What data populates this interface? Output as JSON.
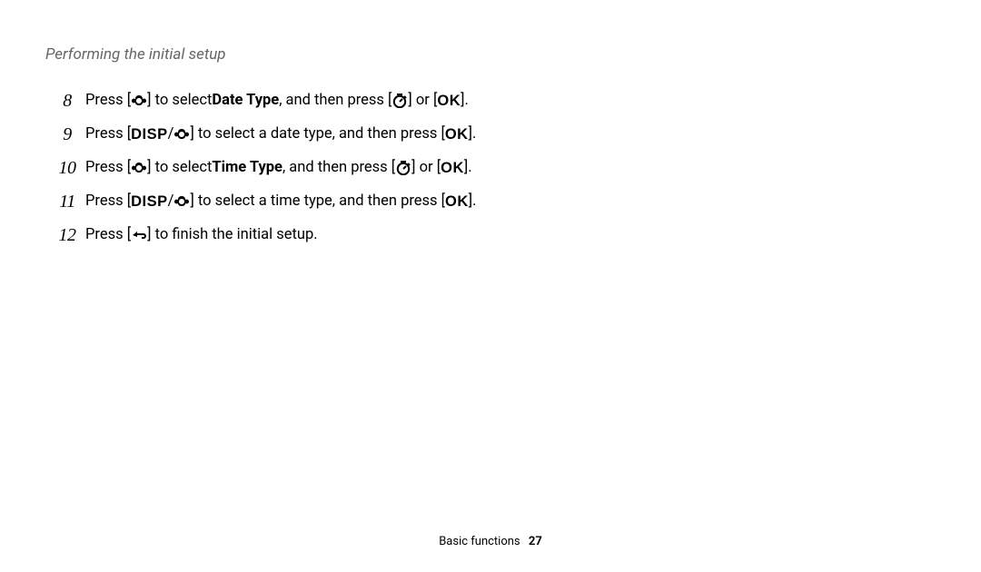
{
  "title": "Performing the initial setup",
  "steps": [
    {
      "n": "8",
      "segments": [
        {
          "t": "text",
          "v": "Press ["
        },
        {
          "t": "icon",
          "v": "macro"
        },
        {
          "t": "text",
          "v": "] to select "
        },
        {
          "t": "bold",
          "v": "Date Type"
        },
        {
          "t": "text",
          "v": ", and then press ["
        },
        {
          "t": "icon",
          "v": "timer"
        },
        {
          "t": "text",
          "v": "] or ["
        },
        {
          "t": "ok",
          "v": "OK"
        },
        {
          "t": "text",
          "v": "]."
        }
      ]
    },
    {
      "n": "9",
      "segments": [
        {
          "t": "text",
          "v": "Press ["
        },
        {
          "t": "disp",
          "v": "DISP"
        },
        {
          "t": "text",
          "v": "/"
        },
        {
          "t": "icon",
          "v": "macro"
        },
        {
          "t": "text",
          "v": "] to select a date type, and then press ["
        },
        {
          "t": "ok",
          "v": "OK"
        },
        {
          "t": "text",
          "v": "]."
        }
      ]
    },
    {
      "n": "10",
      "segments": [
        {
          "t": "text",
          "v": "Press ["
        },
        {
          "t": "icon",
          "v": "macro"
        },
        {
          "t": "text",
          "v": "] to select "
        },
        {
          "t": "bold",
          "v": "Time Type"
        },
        {
          "t": "text",
          "v": ", and then press ["
        },
        {
          "t": "icon",
          "v": "timer"
        },
        {
          "t": "text",
          "v": "] or ["
        },
        {
          "t": "ok",
          "v": "OK"
        },
        {
          "t": "text",
          "v": "]."
        }
      ]
    },
    {
      "n": "11",
      "segments": [
        {
          "t": "text",
          "v": "Press ["
        },
        {
          "t": "disp",
          "v": "DISP"
        },
        {
          "t": "text",
          "v": "/"
        },
        {
          "t": "icon",
          "v": "macro"
        },
        {
          "t": "text",
          "v": "] to select a time type, and then press ["
        },
        {
          "t": "ok",
          "v": "OK"
        },
        {
          "t": "text",
          "v": "]."
        }
      ]
    },
    {
      "n": "12",
      "segments": [
        {
          "t": "text",
          "v": "Press ["
        },
        {
          "t": "icon",
          "v": "back"
        },
        {
          "t": "text",
          "v": "] to finish the initial setup."
        }
      ]
    }
  ],
  "footer": {
    "section": "Basic functions",
    "page": "27"
  },
  "icons": {
    "macro": "macro-icon",
    "timer": "self-timer-icon",
    "back": "back-icon"
  }
}
